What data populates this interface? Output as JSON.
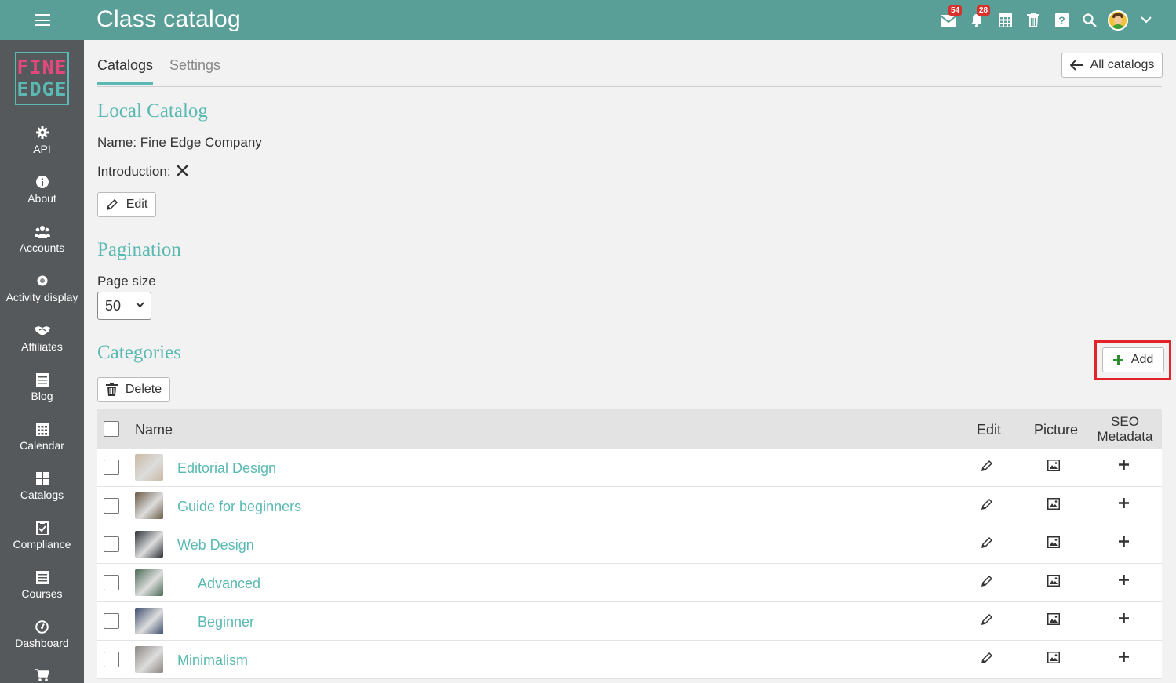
{
  "header": {
    "title": "Class catalog",
    "messages_badge": "54",
    "notifications_badge": "28"
  },
  "logo": {
    "line1": "FINE",
    "line2": "EDGE"
  },
  "sidebar": {
    "items": [
      {
        "label": "API",
        "icon": "gear-icon"
      },
      {
        "label": "About",
        "icon": "info-icon"
      },
      {
        "label": "Accounts",
        "icon": "users-icon"
      },
      {
        "label": "Activity display",
        "icon": "dot-circle-icon"
      },
      {
        "label": "Affiliates",
        "icon": "handshake-icon"
      },
      {
        "label": "Blog",
        "icon": "blog-icon"
      },
      {
        "label": "Calendar",
        "icon": "calendar-icon"
      },
      {
        "label": "Catalogs",
        "icon": "grid-icon"
      },
      {
        "label": "Compliance",
        "icon": "clipboard-check-icon"
      },
      {
        "label": "Courses",
        "icon": "courses-icon"
      },
      {
        "label": "Dashboard",
        "icon": "dashboard-icon"
      },
      {
        "label": "",
        "icon": "cart-icon"
      }
    ]
  },
  "tabs": {
    "catalogs": "Catalogs",
    "settings": "Settings"
  },
  "all_catalogs_label": "All catalogs",
  "local_catalog": {
    "heading": "Local Catalog",
    "name_line": "Name: Fine Edge Company",
    "intro_label": "Introduction:",
    "edit_label": "Edit"
  },
  "pagination": {
    "heading": "Pagination",
    "page_size_label": "Page size",
    "page_size_value": "50"
  },
  "categories": {
    "heading": "Categories",
    "add_label": "Add",
    "delete_label": "Delete",
    "columns": {
      "name": "Name",
      "edit": "Edit",
      "picture": "Picture",
      "seo_line1": "SEO",
      "seo_line2": "Metadata"
    },
    "rows": [
      {
        "name": "Editorial Design",
        "indent": 0,
        "thumb": "#c9b9a2"
      },
      {
        "name": "Guide for beginners",
        "indent": 0,
        "thumb": "#6b5a45"
      },
      {
        "name": "Web Design",
        "indent": 0,
        "thumb": "#2c2f35"
      },
      {
        "name": "Advanced",
        "indent": 1,
        "thumb": "#4a6a55"
      },
      {
        "name": "Beginner",
        "indent": 1,
        "thumb": "#3d4d6e"
      },
      {
        "name": "Minimalism",
        "indent": 0,
        "thumb": "#8a8580"
      }
    ]
  },
  "colors": {
    "teal": "#5a9e98",
    "accent": "#5ab9b2",
    "sidebar": "#55595b",
    "highlight": "#e2232a"
  }
}
